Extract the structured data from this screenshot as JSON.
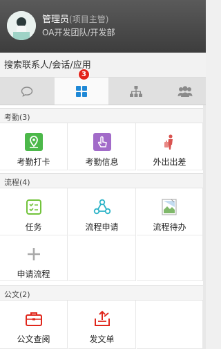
{
  "user": {
    "name": "管理员",
    "role": "(项目主管)",
    "department": "OA开发团队/开发部"
  },
  "search": {
    "placeholder": "搜索联系人/会话/应用"
  },
  "tabs": [
    {
      "name": "messages",
      "icon": "chat-bubble-icon",
      "active": false
    },
    {
      "name": "apps",
      "icon": "grid-icon",
      "active": true,
      "badge": "3"
    },
    {
      "name": "organization",
      "icon": "org-chart-icon",
      "active": false
    },
    {
      "name": "contacts",
      "icon": "people-icon",
      "active": false
    }
  ],
  "sections": [
    {
      "title": "考勤(3)",
      "items": [
        {
          "label": "考勤打卡",
          "icon": "location-icon",
          "color": "#4cb84a"
        },
        {
          "label": "考勤信息",
          "icon": "touch-icon",
          "color": "#a26bc9"
        },
        {
          "label": "外出出差",
          "icon": "traveler-icon",
          "color": "#d9534f"
        }
      ]
    },
    {
      "title": "流程(4)",
      "items": [
        {
          "label": "任务",
          "icon": "checklist-icon",
          "color": "#72c33b"
        },
        {
          "label": "流程申请",
          "icon": "flow-nodes-icon",
          "color": "#2bb3c7"
        },
        {
          "label": "流程待办",
          "icon": "broken-image-icon",
          "color": "#999999"
        },
        {
          "label": "申请流程",
          "icon": "plus-icon",
          "color": "#aaaaaa"
        }
      ]
    },
    {
      "title": "公文(2)",
      "items": [
        {
          "label": "公文查阅",
          "icon": "briefcase-icon",
          "color": "#e0261b"
        },
        {
          "label": "发文单",
          "icon": "send-tray-icon",
          "color": "#e0261b"
        }
      ]
    }
  ]
}
